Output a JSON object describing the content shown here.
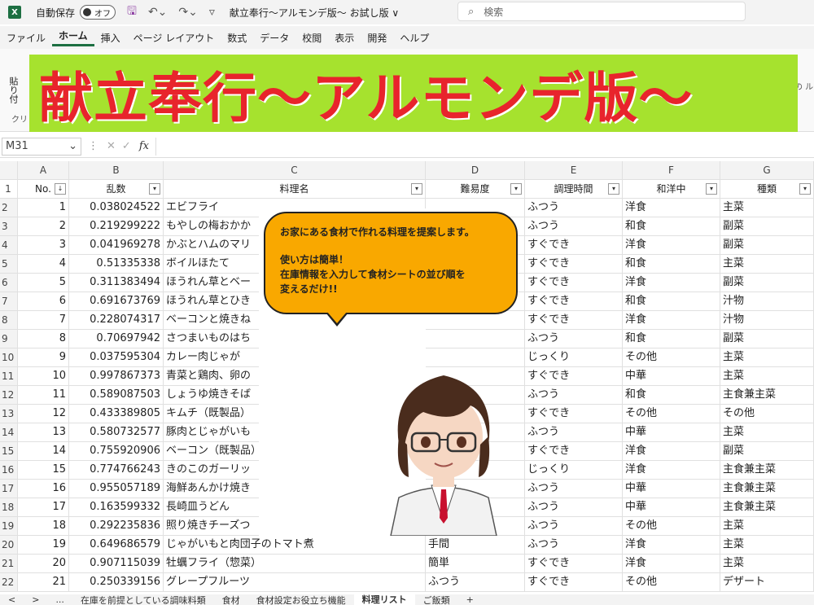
{
  "titlebar": {
    "autosave_label": "自動保存",
    "autosave_state": "オフ",
    "filename": "献立奉行～アルモンデ版～  お試し版 ∨",
    "search_placeholder": "検索"
  },
  "menu": [
    "ファイル",
    "ホーム",
    "挿入",
    "ページ レイアウト",
    "数式",
    "データ",
    "校閲",
    "表示",
    "開発",
    "ヘルプ"
  ],
  "ribbon": {
    "paste": "貼り付",
    "clip": "クリ",
    "right_text": "の\nル"
  },
  "banner": {
    "title": "献立奉行～アルモンデ版～",
    "bg": "#a6e22e",
    "fg": "#e8242c"
  },
  "formula": {
    "namebox": "M31",
    "fx": "fx"
  },
  "columns": [
    "A",
    "B",
    "C",
    "D",
    "E",
    "F",
    "G"
  ],
  "headers": [
    "No.",
    "乱数",
    "料理名",
    "難易度",
    "調理時間",
    "和洋中",
    "種類"
  ],
  "rows": [
    {
      "r": "2",
      "no": "1",
      "rand": "0.038024522",
      "name": "エビフライ",
      "diff": "",
      "time": "ふつう",
      "style": "洋食",
      "kind": "主菜"
    },
    {
      "r": "3",
      "no": "2",
      "rand": "0.219299222",
      "name": "もやしの梅おかか",
      "diff": "",
      "time": "ふつう",
      "style": "和食",
      "kind": "副菜"
    },
    {
      "r": "4",
      "no": "3",
      "rand": "0.041969278",
      "name": "かぶとハムのマリ",
      "diff": "",
      "time": "すぐでき",
      "style": "洋食",
      "kind": "副菜"
    },
    {
      "r": "5",
      "no": "4",
      "rand": "0.51335338",
      "name": "ボイルほたて",
      "diff": "",
      "time": "すぐでき",
      "style": "和食",
      "kind": "主菜"
    },
    {
      "r": "6",
      "no": "5",
      "rand": "0.311383494",
      "name": "ほうれん草とベー",
      "diff": "",
      "time": "すぐでき",
      "style": "洋食",
      "kind": "副菜"
    },
    {
      "r": "7",
      "no": "6",
      "rand": "0.691673769",
      "name": "ほうれん草とひき",
      "diff": "",
      "time": "すぐでき",
      "style": "和食",
      "kind": "汁物"
    },
    {
      "r": "8",
      "no": "7",
      "rand": "0.228074317",
      "name": "ベーコンと焼きね",
      "diff": "",
      "time": "すぐでき",
      "style": "洋食",
      "kind": "汁物"
    },
    {
      "r": "9",
      "no": "8",
      "rand": "0.70697942",
      "name": "さつまいものはち",
      "diff": "",
      "time": "ふつう",
      "style": "和食",
      "kind": "副菜"
    },
    {
      "r": "10",
      "no": "9",
      "rand": "0.037595304",
      "name": "カレー肉じゃが",
      "diff": "",
      "time": "じっくり",
      "style": "その他",
      "kind": "主菜"
    },
    {
      "r": "11",
      "no": "10",
      "rand": "0.997867373",
      "name": "青菜と鶏肉、卵の",
      "diff": "",
      "time": "すぐでき",
      "style": "中華",
      "kind": "主菜"
    },
    {
      "r": "12",
      "no": "11",
      "rand": "0.589087503",
      "name": "しょうゆ焼きそば",
      "diff": "",
      "time": "ふつう",
      "style": "和食",
      "kind": "主食兼主菜"
    },
    {
      "r": "13",
      "no": "12",
      "rand": "0.433389805",
      "name": "キムチ（既製品）",
      "diff": "",
      "time": "すぐでき",
      "style": "その他",
      "kind": "その他"
    },
    {
      "r": "14",
      "no": "13",
      "rand": "0.580732577",
      "name": "豚肉とじゃがいも",
      "diff": "",
      "time": "ふつう",
      "style": "中華",
      "kind": "主菜"
    },
    {
      "r": "15",
      "no": "14",
      "rand": "0.755920906",
      "name": "ベーコン（既製品）",
      "diff": "",
      "time": "すぐでき",
      "style": "洋食",
      "kind": "副菜"
    },
    {
      "r": "16",
      "no": "15",
      "rand": "0.774766243",
      "name": "きのこのガーリッ",
      "diff": "",
      "time": "じっくり",
      "style": "洋食",
      "kind": "主食兼主菜"
    },
    {
      "r": "17",
      "no": "16",
      "rand": "0.955057189",
      "name": "海鮮あんかけ焼き",
      "diff": "",
      "time": "ふつう",
      "style": "中華",
      "kind": "主食兼主菜"
    },
    {
      "r": "18",
      "no": "17",
      "rand": "0.163599332",
      "name": "長崎皿うどん",
      "diff": "",
      "time": "ふつう",
      "style": "中華",
      "kind": "主食兼主菜"
    },
    {
      "r": "19",
      "no": "18",
      "rand": "0.292235836",
      "name": "照り焼きチーズつ",
      "diff": "",
      "time": "ふつう",
      "style": "その他",
      "kind": "主菜"
    },
    {
      "r": "20",
      "no": "19",
      "rand": "0.649686579",
      "name": "じゃがいもと肉団子のトマト煮",
      "diff": "手間",
      "time": "ふつう",
      "style": "洋食",
      "kind": "主菜"
    },
    {
      "r": "21",
      "no": "20",
      "rand": "0.907115039",
      "name": "牡蠣フライ（惣菜）",
      "diff": "簡単",
      "time": "すぐでき",
      "style": "洋食",
      "kind": "主菜"
    },
    {
      "r": "22",
      "no": "21",
      "rand": "0.250339156",
      "name": "グレープフルーツ",
      "diff": "ふつう",
      "time": "すぐでき",
      "style": "その他",
      "kind": "デザート"
    }
  ],
  "bubble": {
    "line1": "お家にある食材で作れる料理を提案します。",
    "line2": "使い方は簡単！",
    "line3": "在庫情報を入力して食材シートの並び順を",
    "line4": "変えるだけ!!"
  },
  "tabs": [
    "<",
    ">",
    "...",
    "在庫を前提としている調味料類",
    "食材",
    "食材設定お役立ち機能",
    "料理リスト",
    "ご飯類",
    "+"
  ],
  "active_tab": "料理リスト"
}
